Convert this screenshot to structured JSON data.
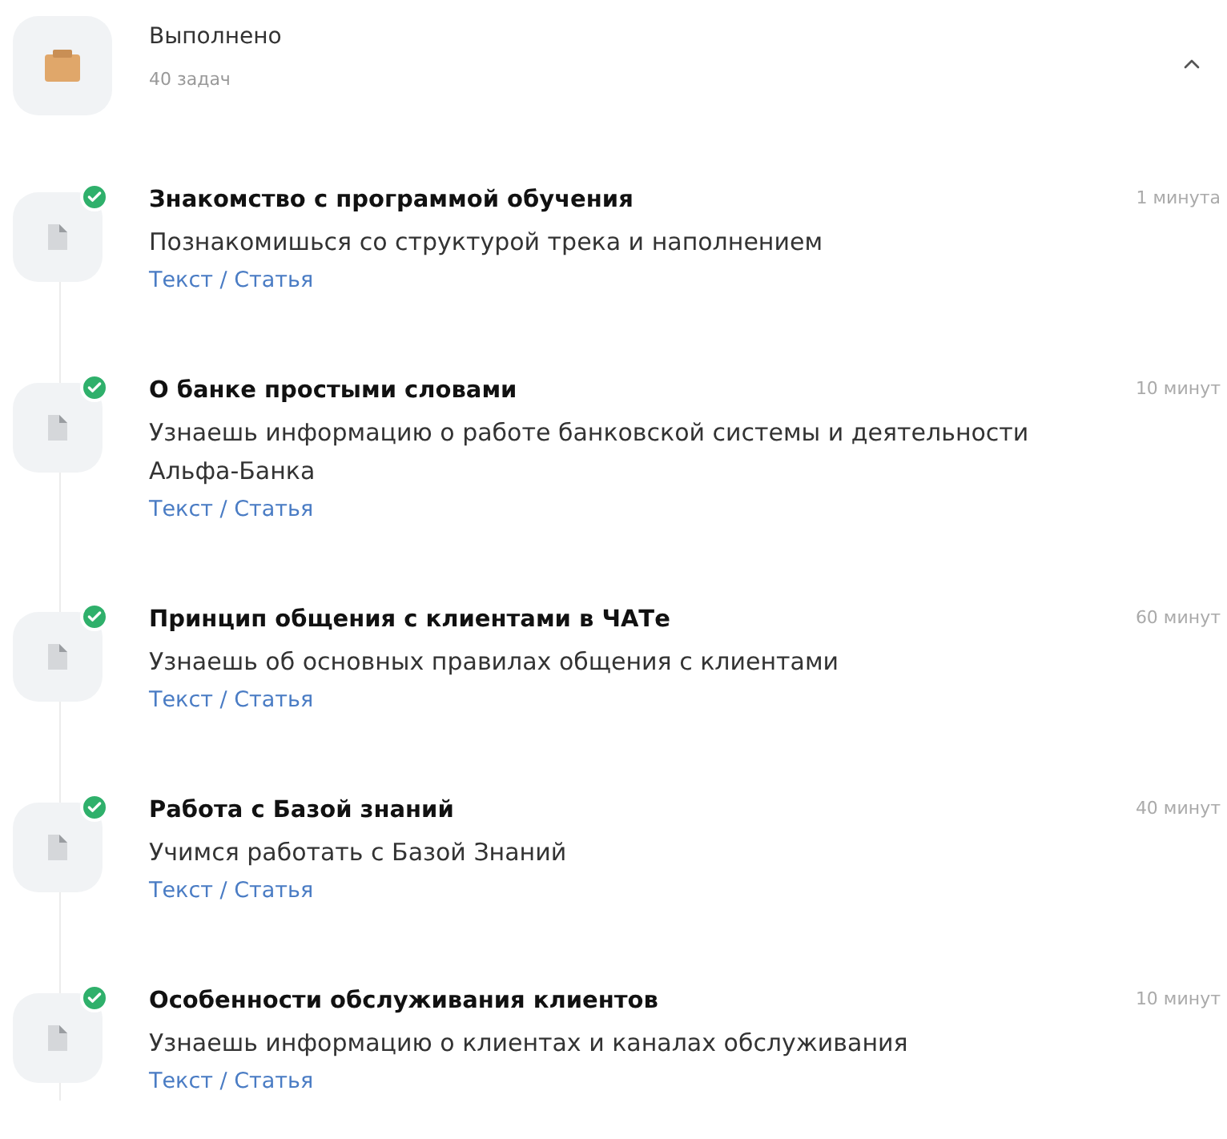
{
  "section": {
    "title": "Выполнено",
    "count": "40 задач",
    "expanded": true
  },
  "tasks": [
    {
      "title": "Знакомство с программой обучения",
      "description": "Познакомишься со структурой трека и наполнением",
      "type": "Текст / Статья",
      "duration": "1 минута",
      "completed": true
    },
    {
      "title": "О банке простыми словами",
      "description": "Узнаешь информацию о работе банковской системы и деятельности Альфа-Банка",
      "type": "Текст / Статья",
      "duration": "10 минут",
      "completed": true
    },
    {
      "title": "Принцип общения с клиентами в ЧАТе",
      "description": "Узнаешь об основных правилах общения с клиентами",
      "type": "Текст / Статья",
      "duration": "60 минут",
      "completed": true
    },
    {
      "title": "Работа с Базой знаний",
      "description": "Учимся работать с Базой Знаний",
      "type": "Текст / Статья",
      "duration": "40 минут",
      "completed": true
    },
    {
      "title": "Особенности обслуживания клиентов",
      "description": "Узнаешь информацию о клиентах и каналах обслуживания",
      "type": "Текст / Статья",
      "duration": "10 минут",
      "completed": true
    }
  ]
}
